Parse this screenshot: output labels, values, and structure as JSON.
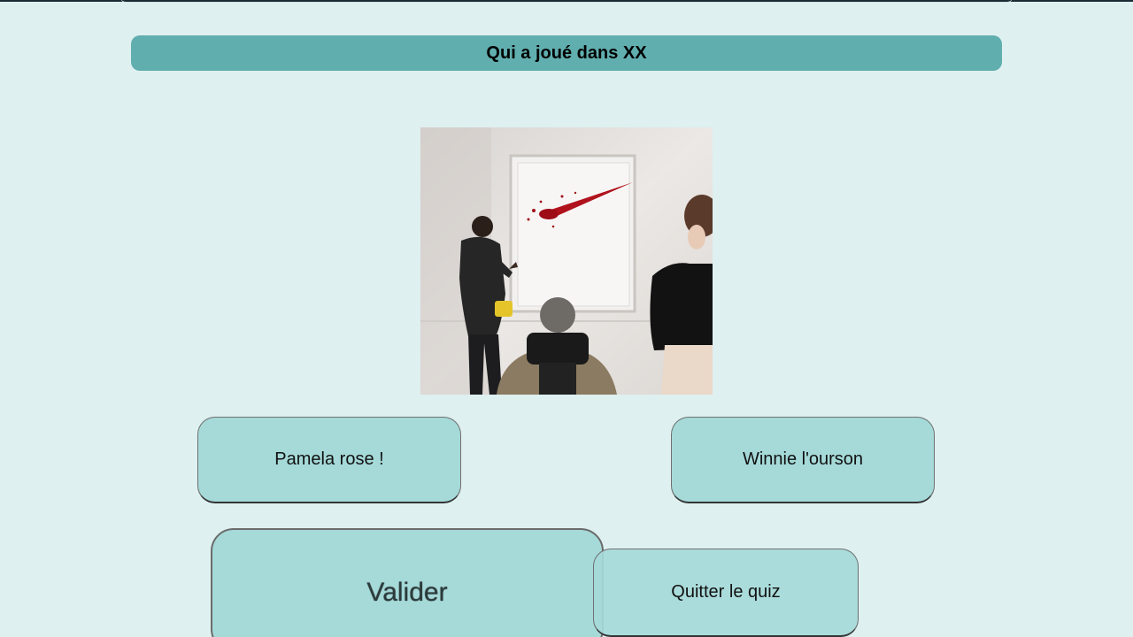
{
  "quiz": {
    "question": "Qui a joué dans XX",
    "image_icon": "movie-still-image",
    "answers": [
      {
        "label": "Pamela rose !"
      },
      {
        "label": "Winnie l'ourson"
      }
    ],
    "validate_label": "Valider",
    "quit_label": "Quitter le quiz"
  },
  "colors": {
    "background": "#def0f0",
    "title_bar": "#61aeaf",
    "button": "#a5dad9",
    "top_bar": "#1c2b33"
  }
}
